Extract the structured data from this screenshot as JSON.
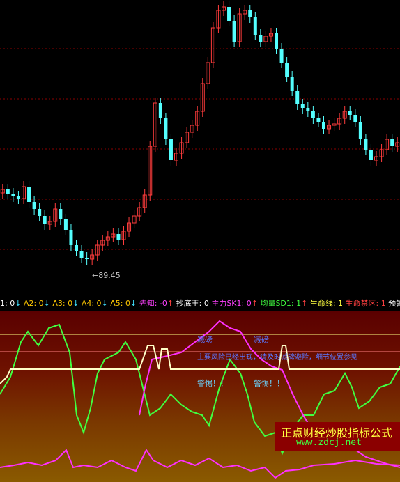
{
  "price_panel": {
    "low_marker": "←89.45"
  },
  "indicator_bar": {
    "items": [
      {
        "label": "1: 0",
        "arrow": "↓",
        "color": "#ffffff"
      },
      {
        "label": "A2: 0",
        "arrow": "↓",
        "color": "#ffc800"
      },
      {
        "label": "A3: 0",
        "arrow": "↓",
        "color": "#ffc800"
      },
      {
        "label": "A4: 0",
        "arrow": "↓",
        "color": "#ffc800"
      },
      {
        "label": "A5: 0",
        "arrow": "↓",
        "color": "#ffc800"
      },
      {
        "label": "先知: -0",
        "arrow": "↑",
        "color": "#ff40ff"
      },
      {
        "label": "抄底王: 0",
        "arrow": "",
        "color": "#ffffff"
      },
      {
        "label": "主力SK1: 0",
        "arrow": "↑",
        "color": "#ff40ff"
      },
      {
        "label": "均量SD1: 1",
        "arrow": "↑",
        "color": "#40ff40"
      },
      {
        "label": "生命线: 1",
        "arrow": "",
        "color": "#ffff40"
      },
      {
        "label": "生命禁区: 1",
        "arrow": "",
        "color": "#ff4040"
      },
      {
        "label": "预警系",
        "arrow": "",
        "color": "#ffffff"
      }
    ]
  },
  "sub_panel": {
    "label_a1": "减磅",
    "label_a2": "减磅",
    "banner": "主要风险已经出现，请及时减磅避险，细节位置参见",
    "label_b1": "警惕！！",
    "label_b2": "警惕！！"
  },
  "watermark": {
    "title": "正点财经炒股指标公式",
    "url": "www.zdcj.net"
  },
  "colors": {
    "up": "#ff3c3c",
    "down": "#54ffff",
    "gridline": "#8b0000",
    "green_line": "#40ff40",
    "magenta_line": "#ff30ff",
    "white_line": "#ffffc8"
  }
}
